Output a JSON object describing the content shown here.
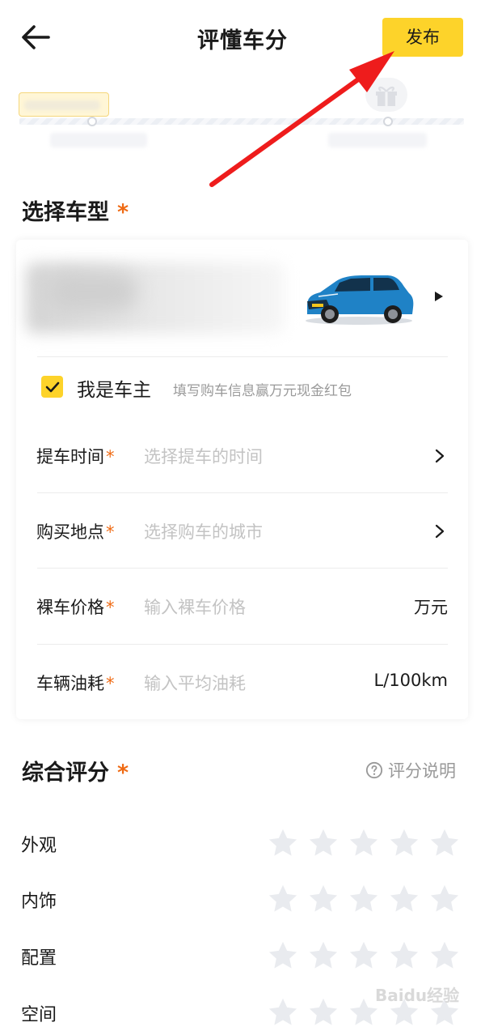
{
  "header": {
    "title": "评懂车分",
    "publish_label": "发布"
  },
  "sections": {
    "select_model_title": "选择车型",
    "overall_rating_title": "综合评分",
    "required_mark": "*"
  },
  "owner": {
    "checked": true,
    "label": "我是车主",
    "hint": "填写购车信息赢万元现金红包"
  },
  "form": {
    "rows": [
      {
        "label": "提车时间",
        "required_mark": "*",
        "placeholder": "选择提车的时间",
        "unit": "",
        "control": "chevron"
      },
      {
        "label": "购买地点",
        "required_mark": "*",
        "placeholder": "选择购车的城市",
        "unit": "",
        "control": "chevron"
      },
      {
        "label": "裸车价格",
        "required_mark": "*",
        "placeholder": "输入裸车价格",
        "unit": "万元",
        "control": "unit"
      },
      {
        "label": "车辆油耗",
        "required_mark": "*",
        "placeholder": "输入平均油耗",
        "unit": "L/100km",
        "control": "unit"
      }
    ]
  },
  "rating": {
    "help_label": "评分说明",
    "help_icon": "question-circle-icon",
    "star_icon": "star-icon",
    "items": [
      {
        "label": "外观",
        "score": 0,
        "max": 5
      },
      {
        "label": "内饰",
        "score": 0,
        "max": 5
      },
      {
        "label": "配置",
        "score": 0,
        "max": 5
      },
      {
        "label": "空间",
        "score": 0,
        "max": 5
      }
    ]
  },
  "colors": {
    "accent": "#fdd32a",
    "required": "#ef6a13",
    "placeholder": "#c3c3c3",
    "star_empty": "#e9ebef",
    "annotation_arrow": "#ee1c1c",
    "car_body": "#1f82c6"
  },
  "watermark": {
    "text": "Baidu经验"
  }
}
